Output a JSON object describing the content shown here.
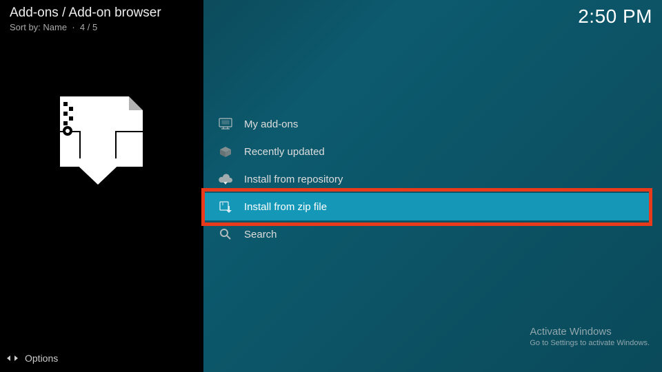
{
  "header": {
    "breadcrumb": "Add-ons / Add-on browser",
    "sort_label": "Sort by: Name",
    "position": "4 / 5",
    "clock": "2:50 PM"
  },
  "menu": {
    "items": [
      {
        "label": "My add-ons",
        "icon": "screen-icon",
        "selected": false
      },
      {
        "label": "Recently updated",
        "icon": "box-icon",
        "selected": false
      },
      {
        "label": "Install from repository",
        "icon": "cloud-down-icon",
        "selected": false
      },
      {
        "label": "Install from zip file",
        "icon": "zip-install-icon",
        "selected": true
      },
      {
        "label": "Search",
        "icon": "search-icon",
        "selected": false
      }
    ]
  },
  "watermark": {
    "line1": "Activate Windows",
    "line2": "Go to Settings to activate Windows."
  },
  "footer": {
    "options": "Options"
  }
}
